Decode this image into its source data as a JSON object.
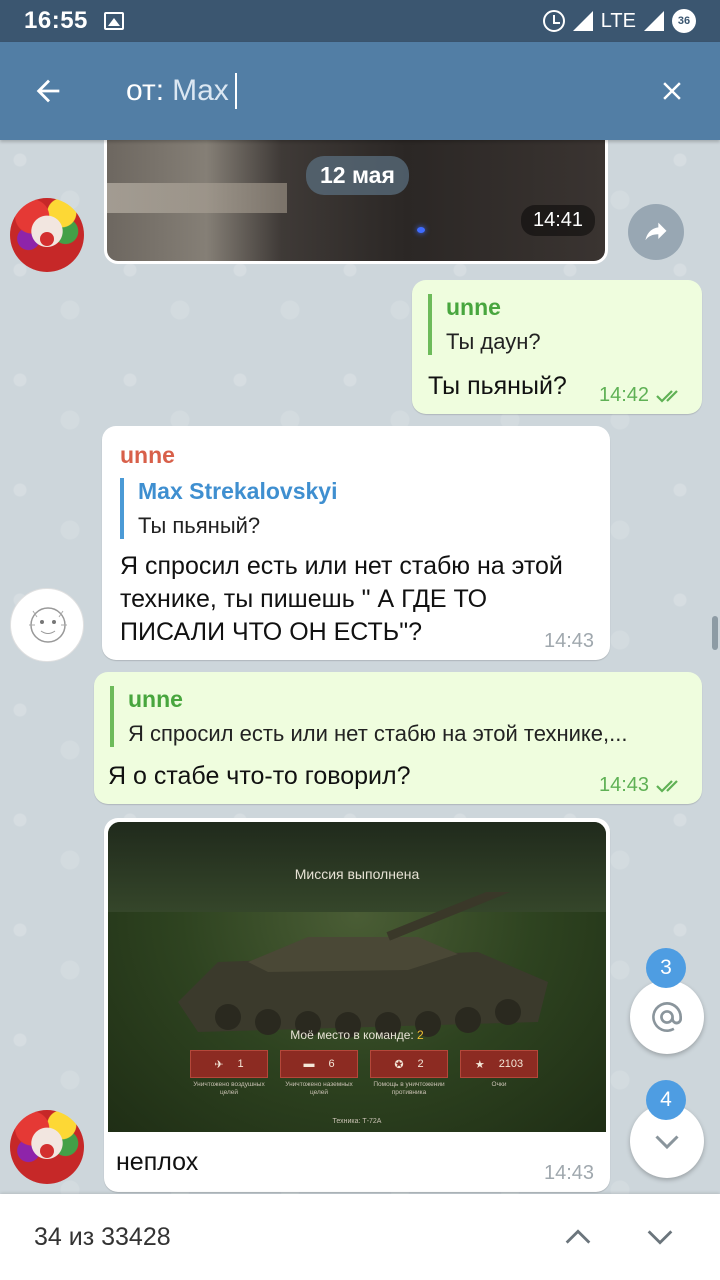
{
  "status_bar": {
    "time": "16:55",
    "network": "LTE",
    "battery": "36"
  },
  "search": {
    "prefix": "от:",
    "query": "Max"
  },
  "date_label": "12 мая",
  "messages": [
    {
      "type": "media",
      "time": "14:41"
    },
    {
      "type": "out",
      "reply_name": "unne",
      "reply_text": "Ты даун?",
      "text": "Ты пьяный?",
      "time": "14:42"
    },
    {
      "type": "in",
      "sender": "unne",
      "reply_name": "Max Strekalovskyi",
      "reply_text": "Ты пьяный?",
      "text": "Я спросил есть или нет стабю на этой технике, ты пишешь \" А ГДЕ ТО ПИСАЛИ ЧТО ОН ЕСТЬ\"?",
      "time": "14:43"
    },
    {
      "type": "out",
      "reply_name": "unne",
      "reply_text": "Я спросил есть или нет стабю на этой технике,...",
      "text": "Я о стабе что-то говорил?",
      "time": "14:43"
    },
    {
      "type": "in-photo",
      "caption": "неплох",
      "time": "14:43",
      "game": {
        "mission": "Миссия выполнена",
        "place_label": "Моё место в команде:",
        "place_value": "2",
        "stats": [
          {
            "value": "1",
            "label": "Уничтожено воздушных целей"
          },
          {
            "value": "6",
            "label": "Уничтожено наземных целей"
          },
          {
            "value": "2",
            "label": "Помощь в уничтожении противника"
          },
          {
            "value": "2103",
            "label": "Очки"
          }
        ],
        "technique": "Техника: Т-72А"
      }
    }
  ],
  "fabs": {
    "mentions_count": "3",
    "scroll_down_count": "4"
  },
  "bottom": {
    "counter": "34 из 33428"
  }
}
